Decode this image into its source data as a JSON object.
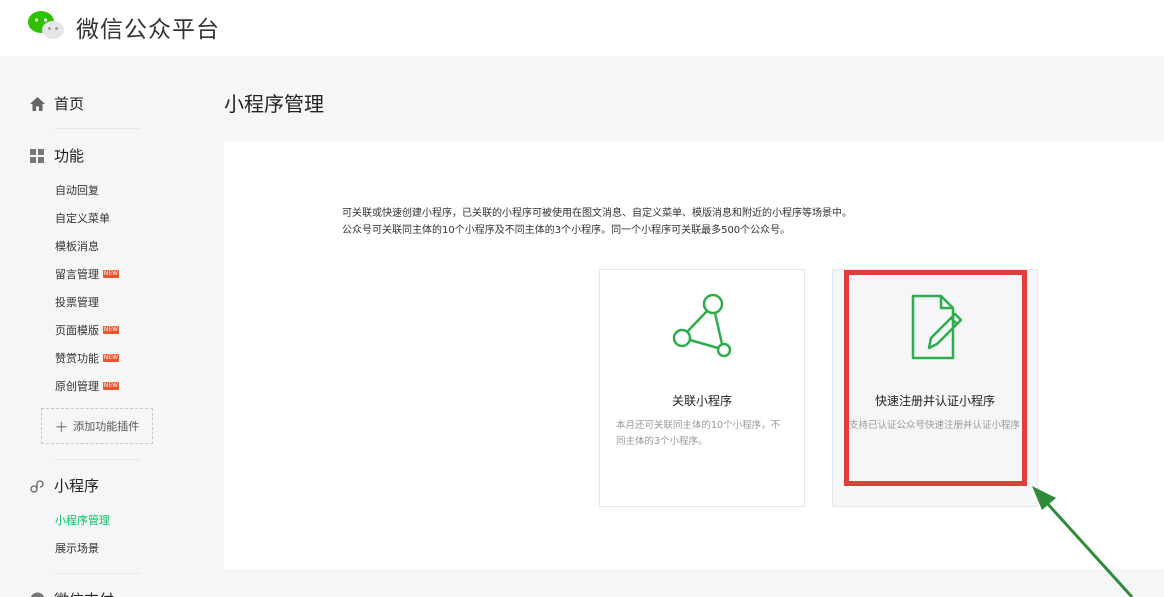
{
  "header": {
    "title": "微信公众平台",
    "logo_icon": "wechat-logo-icon"
  },
  "sidebar": {
    "home": {
      "label": "首页",
      "icon": "home-icon"
    },
    "features": {
      "label": "功能",
      "icon": "grid-icon",
      "items": [
        {
          "label": "自动回复",
          "badge": ""
        },
        {
          "label": "自定义菜单",
          "badge": ""
        },
        {
          "label": "模板消息",
          "badge": ""
        },
        {
          "label": "留言管理",
          "badge": "NEW"
        },
        {
          "label": "投票管理",
          "badge": ""
        },
        {
          "label": "页面模版",
          "badge": "NEW"
        },
        {
          "label": "赞赏功能",
          "badge": "NEW"
        },
        {
          "label": "原创管理",
          "badge": "NEW"
        }
      ],
      "add_plugin": "添加功能插件"
    },
    "miniprogram": {
      "label": "小程序",
      "icon": "link-icon",
      "items": [
        {
          "label": "小程序管理",
          "active": true
        },
        {
          "label": "展示场景",
          "active": false
        }
      ]
    },
    "next_section": {
      "label": "微信支付"
    }
  },
  "main": {
    "title": "小程序管理",
    "description_line1": "可关联或快速创建小程序，已关联的小程序可被使用在图文消息、自定义菜单、模版消息和附近的小程序等场景中。",
    "description_line2": "公众号可关联同主体的10个小程序及不同主体的3个小程序。同一个小程序可关联最多500个公众号。",
    "cards": [
      {
        "title": "关联小程序",
        "desc": "本月还可关联同主体的10个小程序，不同主体的3个小程序。",
        "icon": "share-nodes-icon"
      },
      {
        "title": "快速注册并认证小程序",
        "desc": "支持已认证公众号快速注册并认证小程序",
        "icon": "document-edit-icon"
      }
    ]
  },
  "colors": {
    "accent": "#07c160",
    "highlight": "#e43b3b",
    "arrow": "#2e8b3a",
    "badge": "#e8552d"
  }
}
